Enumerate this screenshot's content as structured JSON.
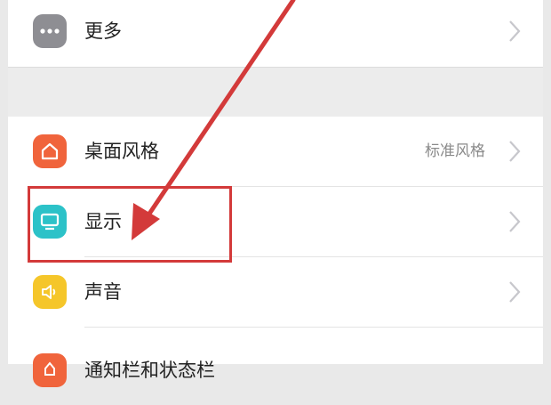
{
  "settings": {
    "more": {
      "label": "更多",
      "icon": "more-dots-icon"
    },
    "desktop_style": {
      "label": "桌面风格",
      "value": "标准风格",
      "icon": "home-icon"
    },
    "display": {
      "label": "显示",
      "icon": "display-icon"
    },
    "sound": {
      "label": "声音",
      "icon": "speaker-icon"
    },
    "notification_bar": {
      "label": "通知栏和状态栏",
      "icon": "notification-icon"
    }
  },
  "colors": {
    "more_icon_bg": "#8e8e93",
    "desktop_icon_bg": "#f0643c",
    "display_icon_bg": "#2cc2c8",
    "sound_icon_bg": "#f5c62a",
    "notify_icon_bg": "#f0643c",
    "annotation": "#d33a3a"
  }
}
